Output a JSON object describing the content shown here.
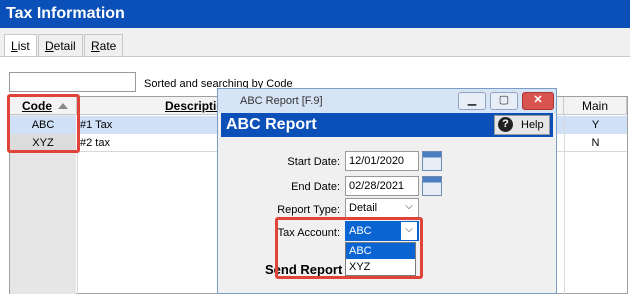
{
  "window": {
    "title": "Tax Information"
  },
  "tabs": [
    {
      "label": "List",
      "underline": "L",
      "rest": "ist"
    },
    {
      "label": "Detail",
      "underline": "D",
      "rest": "etail"
    },
    {
      "label": "Rate",
      "underline": "R",
      "rest": "ate"
    }
  ],
  "list": {
    "search_placeholder": "",
    "sort_hint": "Sorted and searching by Code",
    "columns": {
      "code": "Code",
      "description": "Description",
      "main": "Main"
    },
    "rows": [
      {
        "code": "ABC",
        "description": "#1 Tax",
        "main": "Y"
      },
      {
        "code": "XYZ",
        "description": "#2 tax",
        "main": "N"
      }
    ]
  },
  "dialog": {
    "title": "ABC Report [F.9]",
    "heading": "ABC Report",
    "help_label": "Help",
    "start_date_label": "Start Date:",
    "start_date": "12/01/2020",
    "end_date_label": "End Date:",
    "end_date": "02/28/2021",
    "report_type_label": "Report Type:",
    "report_type": "Detail",
    "tax_account_label": "Tax Account:",
    "tax_account": "ABC",
    "tax_account_options": [
      "ABC",
      "XYZ"
    ],
    "send_report_label": "Send Report"
  },
  "colors": {
    "accent": "#0b4fb8",
    "highlight": "#e0433a",
    "selection": "#0a64d2"
  }
}
